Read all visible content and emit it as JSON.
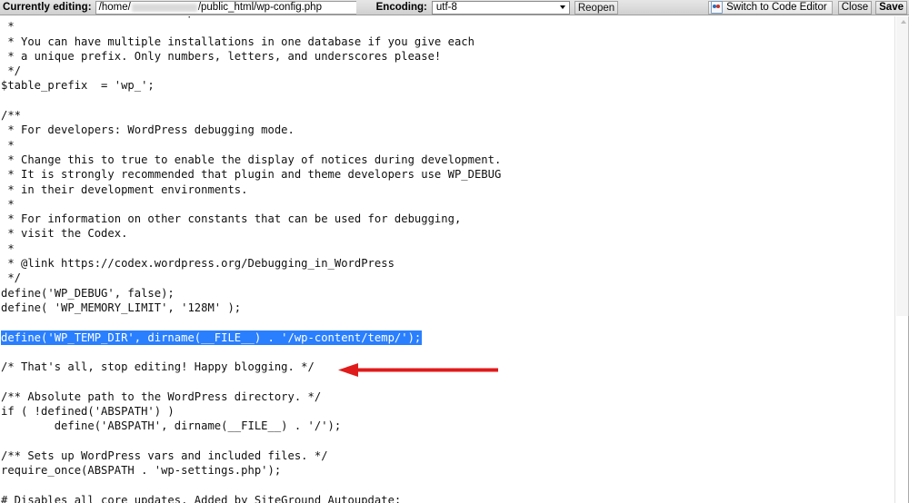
{
  "toolbar": {
    "currently_editing_label": "Currently editing:",
    "file_path_prefix": "/home/",
    "file_path_suffix": "/public_html/wp-config.php",
    "encoding_label": "Encoding:",
    "encoding_value": "utf-8",
    "encoding_options": [
      "utf-8"
    ],
    "reopen_label": "Reopen",
    "switch_editor_label": "Switch to Code Editor",
    "switch_editor_icon": "code-page-icon",
    "close_label": "Close",
    "save_label": "Save"
  },
  "editor": {
    "language": "php",
    "selection_color": "#2a7fff",
    "selection_text_color": "#ffffff",
    "selected_line_index": 22,
    "lines": [
      " * WordPress Database Table prefix.",
      " *",
      " * You can have multiple installations in one database if you give each",
      " * a unique prefix. Only numbers, letters, and underscores please!",
      " */",
      "$table_prefix  = 'wp_';",
      "",
      "/**",
      " * For developers: WordPress debugging mode.",
      " *",
      " * Change this to true to enable the display of notices during development.",
      " * It is strongly recommended that plugin and theme developers use WP_DEBUG",
      " * in their development environments.",
      " *",
      " * For information on other constants that can be used for debugging,",
      " * visit the Codex.",
      " *",
      " * @link https://codex.wordpress.org/Debugging_in_WordPress",
      " */",
      "define('WP_DEBUG', false);",
      "define( 'WP_MEMORY_LIMIT', '128M' );",
      "",
      "define('WP_TEMP_DIR', dirname(__FILE__) . '/wp-content/temp/');",
      "",
      "/* That's all, stop editing! Happy blogging. */",
      "",
      "/** Absolute path to the WordPress directory. */",
      "if ( !defined('ABSPATH') )",
      "        define('ABSPATH', dirname(__FILE__) . '/');",
      "",
      "/** Sets up WordPress vars and included files. */",
      "require_once(ABSPATH . 'wp-settings.php');",
      "",
      "# Disables all core updates. Added by SiteGround Autoupdate;"
    ]
  },
  "annotation": {
    "arrow_color": "#e01b1b",
    "arrow_direction": "left",
    "arrow_target_line": "/* That's all, stop editing! Happy blogging. */"
  },
  "scrollbar": {
    "orientation": "vertical",
    "thumb_top_percent": 0,
    "thumb_height_percent": 62
  }
}
